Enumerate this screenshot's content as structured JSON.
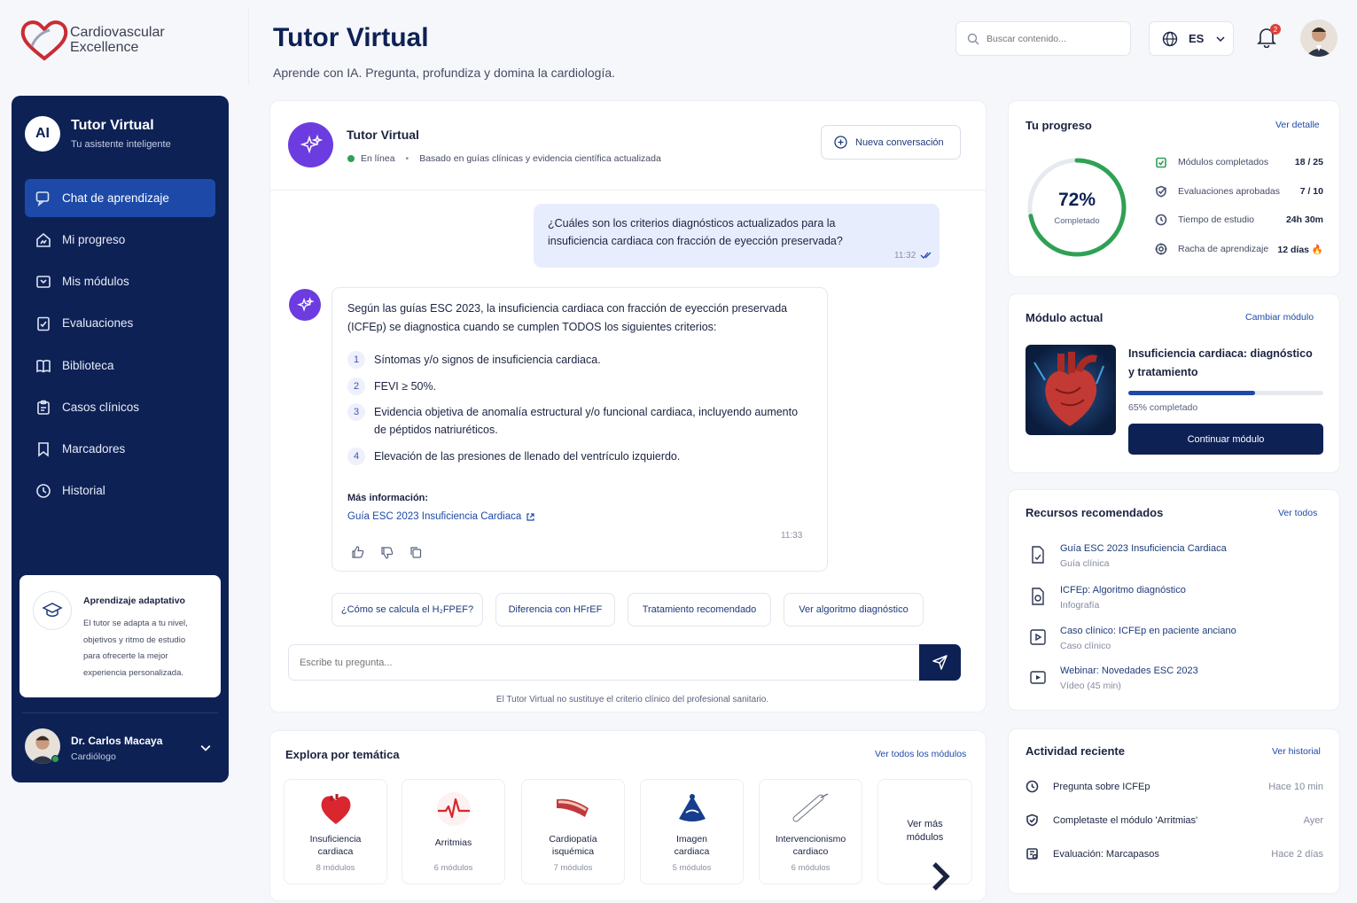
{
  "brand": {
    "line1": "Cardiovascular",
    "line2": "Excellence"
  },
  "header": {
    "title": "Tutor Virtual",
    "subtitle": "Aprende con IA. Pregunta, profundiza y domina la cardiología.",
    "search_placeholder": "Buscar contenido...",
    "language": "ES",
    "notifications": "2"
  },
  "sidebar": {
    "avatar": "AI",
    "title": "Tutor Virtual",
    "subtitle": "Tu asistente inteligente",
    "items": [
      {
        "label": "Chat de aprendizaje",
        "icon": "chat-icon"
      },
      {
        "label": "Mi progreso",
        "icon": "progress-icon"
      },
      {
        "label": "Mis módulos",
        "icon": "modules-icon"
      },
      {
        "label": "Evaluaciones",
        "icon": "evaluations-icon"
      },
      {
        "label": "Biblioteca",
        "icon": "book-icon"
      },
      {
        "label": "Casos clínicos",
        "icon": "clipboard-icon"
      },
      {
        "label": "Marcadores",
        "icon": "bookmark-icon"
      },
      {
        "label": "Historial",
        "icon": "history-icon"
      }
    ],
    "adaptive": {
      "title": "Aprendizaje adaptativo",
      "text1": "El tutor se adapta a tu nivel,",
      "text2": "objetivos y ritmo de estudio",
      "text3": "para ofrecerte la mejor",
      "text4": "experiencia personalizada."
    },
    "user": {
      "name": "Dr. Carlos Macaya",
      "role": "Cardiólogo"
    }
  },
  "chat": {
    "title": "Tutor Virtual",
    "status": "En línea",
    "status_sep": "•",
    "basis": "Basado en guías clínicas y evidencia científica actualizada",
    "new_button": "Nueva conversación",
    "user_msg": {
      "line1": "¿Cuáles son los criterios diagnósticos actualizados para la",
      "line2": "insuficiencia cardiaca con fracción de eyección preservada?",
      "time": "11:32"
    },
    "bot_msg": {
      "intro1": "Según las guías ESC 2023, la insuficiencia cardiaca con fracción de eyección preservada",
      "intro2": "(ICFEp) se diagnostica cuando se cumplen TODOS los siguientes criterios:",
      "items": [
        {
          "n": "1",
          "text": "Síntomas y/o signos de insuficiencia cardiaca."
        },
        {
          "n": "2",
          "text": "FEVI ≥ 50%."
        },
        {
          "n": "3",
          "text": "Evidencia objetiva de anomalía estructural y/o funcional cardiaca, incluyendo aumento",
          "text2": "de péptidos natriuréticos."
        },
        {
          "n": "4",
          "text": "Elevación de las presiones de llenado del ventrículo izquierdo."
        }
      ],
      "more_label": "Más información:",
      "more_link": "Guía ESC 2023 Insuficiencia Cardiaca",
      "time": "11:33"
    },
    "suggestions": [
      "¿Cómo se calcula el H₂FPEF?",
      "Diferencia con HFrEF",
      "Tratamiento recomendado",
      "Ver algoritmo diagnóstico"
    ],
    "input_placeholder": "Escribe tu pregunta...",
    "disclaimer": "El Tutor Virtual no sustituye el criterio clínico del profesional sanitario."
  },
  "explore": {
    "title": "Explora por temática",
    "link": "Ver todos los módulos",
    "topics": [
      {
        "name1": "Insuficiencia",
        "name2": "cardiaca",
        "count": "8 módulos"
      },
      {
        "name1": "Arritmias",
        "name2": "",
        "count": "6 módulos"
      },
      {
        "name1": "Cardiopatía",
        "name2": "isquémica",
        "count": "7 módulos"
      },
      {
        "name1": "Imagen",
        "name2": "cardiaca",
        "count": "5 módulos"
      },
      {
        "name1": "Intervencionismo",
        "name2": "cardiaco",
        "count": "6 módulos"
      }
    ],
    "more1": "Ver más",
    "more2": "módulos"
  },
  "progress": {
    "title": "Tu progreso",
    "link": "Ver detalle",
    "percent": "72%",
    "percent_value": 72,
    "percent_label": "Completado",
    "rows": [
      {
        "label": "Módulos completados",
        "value": "18 / 25"
      },
      {
        "label": "Evaluaciones aprobadas",
        "value": "7 / 10"
      },
      {
        "label": "Tiempo de estudio",
        "value": "24h 30m"
      },
      {
        "label": "Racha de aprendizaje",
        "value": "12 días 🔥"
      }
    ]
  },
  "module": {
    "title": "Módulo actual",
    "link": "Cambiar módulo",
    "name1": "Insuficiencia cardiaca: diagnóstico",
    "name2": "y tratamiento",
    "progress_value": 65,
    "progress_text": "65% completado",
    "button": "Continuar módulo"
  },
  "resources": {
    "title": "Recursos recomendados",
    "link": "Ver todos",
    "items": [
      {
        "title": "Guía ESC 2023 Insuficiencia Cardiaca",
        "type": "Guía clínica"
      },
      {
        "title": "ICFEp: Algoritmo diagnóstico",
        "type": "Infografía"
      },
      {
        "title": "Caso clínico: ICFEp en paciente anciano",
        "type": "Caso clínico"
      },
      {
        "title": "Webinar: Novedades ESC 2023",
        "type": "Vídeo (45 min)"
      }
    ]
  },
  "activity": {
    "title": "Actividad reciente",
    "link": "Ver historial",
    "items": [
      {
        "text": "Pregunta sobre ICFEp",
        "time": "Hace 10 min"
      },
      {
        "text": "Completaste el módulo 'Arritmias'",
        "time": "Ayer"
      },
      {
        "text": "Evaluación: Marcapasos",
        "time": "Hace 2 días"
      }
    ]
  },
  "colors": {
    "navy": "#0d2155",
    "accent": "#1d4aa8",
    "purple": "#6c3ce0",
    "green": "#2fa155",
    "danger": "#e0403a"
  }
}
